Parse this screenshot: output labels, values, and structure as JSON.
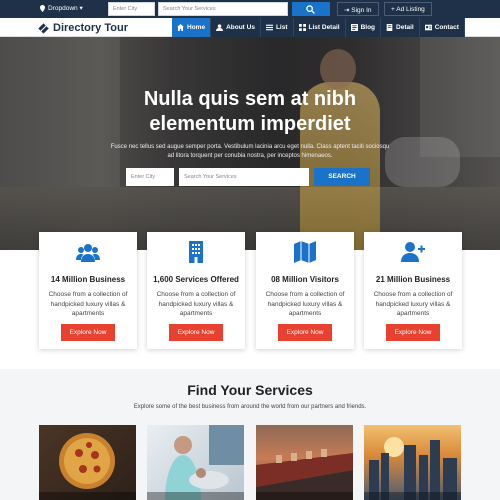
{
  "topbar": {
    "dropdown_label": "Dropdown",
    "city_placeholder": "Enter City",
    "search_placeholder": "Search Your Services",
    "signin_label": "Sign In",
    "add_listing_label": "Ad Listing"
  },
  "brand": {
    "name": "Directory Tour"
  },
  "nav": {
    "items": [
      {
        "label": "Home",
        "icon": "home-icon"
      },
      {
        "label": "About Us",
        "icon": "user-icon"
      },
      {
        "label": "List",
        "icon": "list-icon"
      },
      {
        "label": "List Detail",
        "icon": "list-detail-icon"
      },
      {
        "label": "Blog",
        "icon": "blog-icon"
      },
      {
        "label": "Detail",
        "icon": "detail-icon"
      },
      {
        "label": "Contact",
        "icon": "contact-icon"
      }
    ],
    "active": "Home"
  },
  "hero": {
    "title_line1": "Nulla quis sem at nibh",
    "title_line2": "elementum imperdiet",
    "subtitle": "Fusce nec tellus sed augue semper porta. Vestibulum lacinia arcu eget nulla. Class aptent taciti sociosqu ad litora torquent per conubia nostra, per inceptos himenaeos.",
    "city_placeholder": "Enter City",
    "search_placeholder": "Search Your Services",
    "search_button": "SEARCH"
  },
  "features": [
    {
      "title": "14 Million Business",
      "text": "Choose from a collection of handpicked luxury villas & apartments",
      "button": "Explore Now",
      "icon": "users-icon"
    },
    {
      "title": "1,600 Services Offered",
      "text": "Choose from a collection of handpicked luxury villas & apartments",
      "button": "Explore Now",
      "icon": "building-icon"
    },
    {
      "title": "08 Million Visitors",
      "text": "Choose from a collection of handpicked luxury villas & apartments",
      "button": "Explore Now",
      "icon": "map-icon"
    },
    {
      "title": "21 Million Business",
      "text": "Choose from a collection of handpicked luxury villas & apartments",
      "button": "Explore Now",
      "icon": "user-plus-icon"
    }
  ],
  "services": {
    "title": "Find Your Services",
    "subtitle": "Explore some of the best business from around the world from our partners and friends."
  },
  "colors": {
    "navy": "#1e3148",
    "blue": "#1a73c9",
    "red": "#e8412f"
  }
}
